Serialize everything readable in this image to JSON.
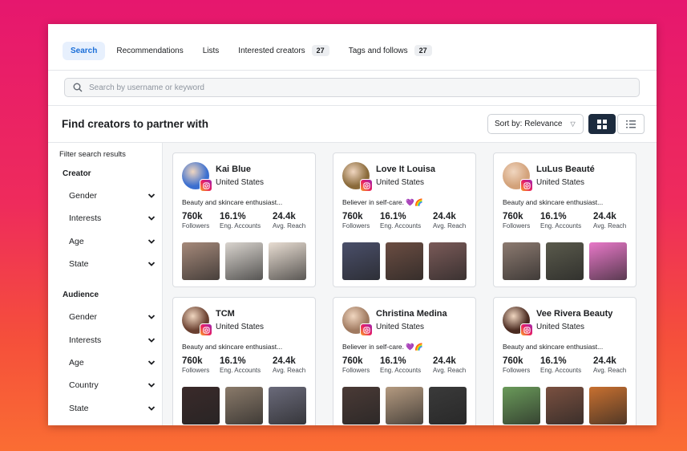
{
  "tabs": [
    {
      "label": "Search",
      "active": true
    },
    {
      "label": "Recommendations"
    },
    {
      "label": "Lists"
    },
    {
      "label": "Interested creators",
      "count": "27"
    },
    {
      "label": "Tags and follows",
      "count": "27"
    }
  ],
  "search": {
    "placeholder": "Search by username or keyword",
    "value": ""
  },
  "page_title": "Find creators to partner with",
  "sort": {
    "label": "Sort by: Relevance"
  },
  "view_toggle": {
    "selected": "grid",
    "options": [
      "grid-icon",
      "list-icon"
    ]
  },
  "sidebar": {
    "title": "Filter search results",
    "groups": [
      {
        "title": "Creator",
        "items": [
          "Gender",
          "Interests",
          "Age",
          "State"
        ]
      },
      {
        "title": "Audience",
        "items": [
          "Gender",
          "Interests",
          "Age",
          "Country",
          "State"
        ]
      }
    ]
  },
  "creators": [
    {
      "name": "Kai Blue",
      "location": "United States",
      "bio": "Beauty and skincare enthusiast...",
      "stats": [
        {
          "value": "760k",
          "label": "Followers"
        },
        {
          "value": "16.1%",
          "label": "Eng. Accounts"
        },
        {
          "value": "24.4k",
          "label": "Avg. Reach"
        }
      ],
      "avatar_color": "#3b6fd0",
      "thumb_colors": [
        "#a5897a",
        "#d9d4ce",
        "#e8ddd2"
      ]
    },
    {
      "name": "Love It Louisa",
      "location": "United States",
      "bio": "Believer in self-care. 💜🌈",
      "stats": [
        {
          "value": "760k",
          "label": "Followers"
        },
        {
          "value": "16.1%",
          "label": "Eng. Accounts"
        },
        {
          "value": "24.4k",
          "label": "Avg. Reach"
        }
      ],
      "avatar_color": "#8a6a3a",
      "thumb_colors": [
        "#4a4f6a",
        "#6b4d42",
        "#7a5a58"
      ]
    },
    {
      "name": "LuLus Beauté",
      "location": "United States",
      "bio": "Beauty and skincare enthusiast...",
      "stats": [
        {
          "value": "760k",
          "label": "Followers"
        },
        {
          "value": "16.1%",
          "label": "Eng. Accounts"
        },
        {
          "value": "24.4k",
          "label": "Avg. Reach"
        }
      ],
      "avatar_color": "#d3a27a",
      "thumb_colors": [
        "#8c7a70",
        "#5a5a4c",
        "#e878c8"
      ]
    },
    {
      "name": "TCM",
      "location": "United States",
      "bio": "Beauty and skincare enthusiast...",
      "stats": [
        {
          "value": "760k",
          "label": "Followers"
        },
        {
          "value": "16.1%",
          "label": "Eng. Accounts"
        },
        {
          "value": "24.4k",
          "label": "Avg. Reach"
        }
      ],
      "avatar_color": "#6a4030",
      "thumb_colors": [
        "#3a2a2a",
        "#8a7a6a",
        "#6a6a7a"
      ]
    },
    {
      "name": "Christina Medina",
      "location": "United States",
      "bio": "Believer in self-care. 💜🌈",
      "stats": [
        {
          "value": "760k",
          "label": "Followers"
        },
        {
          "value": "16.1%",
          "label": "Eng. Accounts"
        },
        {
          "value": "24.4k",
          "label": "Avg. Reach"
        }
      ],
      "avatar_color": "#a07a60",
      "thumb_colors": [
        "#4a3a36",
        "#b49a80",
        "#3a3a3a"
      ]
    },
    {
      "name": "Vee Rivera Beauty",
      "location": "United States",
      "bio": "Beauty and skincare enthusiast...",
      "stats": [
        {
          "value": "760k",
          "label": "Followers"
        },
        {
          "value": "16.1%",
          "label": "Eng. Accounts"
        },
        {
          "value": "24.4k",
          "label": "Avg. Reach"
        }
      ],
      "avatar_color": "#4a2a20",
      "thumb_colors": [
        "#6a9a5a",
        "#7a5040",
        "#c87030"
      ]
    }
  ],
  "colors": {
    "accent": "#1a6ed8",
    "dark_toggle": "#1c2b3e",
    "background_top": "#e6176e",
    "background_bottom": "#fa6d33"
  }
}
